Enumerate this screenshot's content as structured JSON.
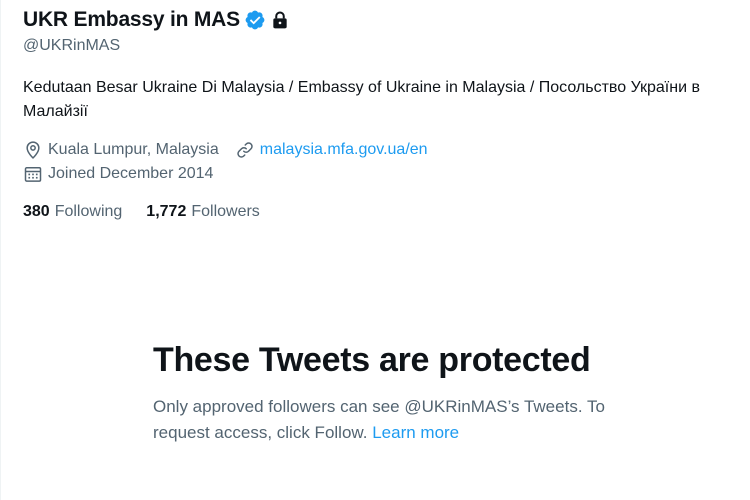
{
  "profile": {
    "display_name": "UKR Embassy in MAS",
    "handle": "@UKRinMAS",
    "bio": "Kedutaan Besar Ukraine Di Malaysia / Embassy of Ukraine in Malaysia / Посольство України в Малайзії",
    "location": "Kuala Lumpur, Malaysia",
    "website": "malaysia.mfa.gov.ua/en",
    "joined": "Joined December 2014",
    "following_count": "380",
    "following_label": "Following",
    "followers_count": "1,772",
    "followers_label": "Followers",
    "icons": {
      "verified": "verified-badge-icon",
      "lock": "lock-icon",
      "location": "location-pin-icon",
      "link": "link-icon",
      "calendar": "calendar-icon"
    }
  },
  "protected_notice": {
    "title": "These Tweets are protected",
    "body": "Only approved followers can see @UKRinMAS’s Tweets. To request access, click Follow.",
    "learn_more": "Learn more"
  },
  "colors": {
    "accent": "#1d9bf0",
    "text_primary": "#0f1419",
    "text_secondary": "#536471"
  }
}
